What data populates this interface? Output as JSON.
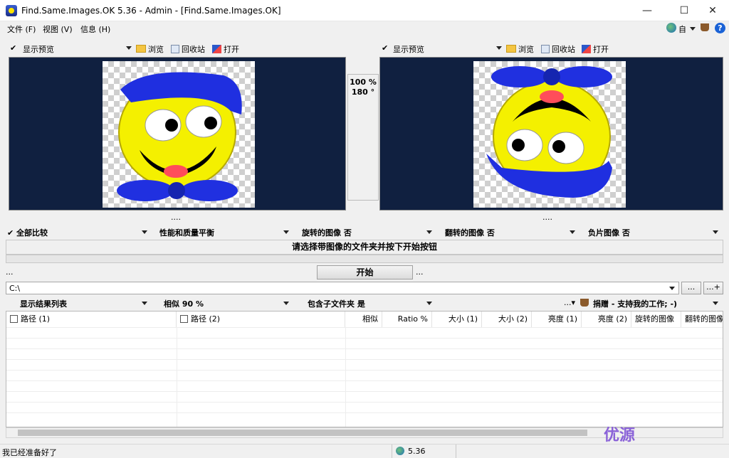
{
  "window": {
    "title": "Find.Same.Images.OK 5.36 - Admin - [Find.Same.Images.OK]",
    "minimize": "—",
    "maximize": "☐",
    "close": "✕"
  },
  "menu": {
    "file": "文件 (F)",
    "view": "视图 (V)",
    "info": "信息 (H)"
  },
  "left_toolbar": {
    "show_preview": "显示预览",
    "browse": "浏览",
    "recycle": "回收站",
    "open": "打开"
  },
  "right_toolbar": {
    "show_preview": "显示预览",
    "browse": "浏览",
    "recycle": "回收站",
    "open": "打开"
  },
  "zoom": {
    "percent": "100 %",
    "rotation": "180 °"
  },
  "dots": "....",
  "options": {
    "compare_all": "全部比较",
    "balance": "性能和质量平衡",
    "rotated": "旋转的图像 否",
    "flipped": "翻转的图像 否",
    "negative": "负片图像 否"
  },
  "status_message": "请选择带图像的文件夹并按下开始按钮",
  "start": {
    "left_dots": "...",
    "label": "开始",
    "right_dots": "..."
  },
  "path": {
    "value": "C:\\",
    "browse_btn": "...",
    "add_btn": "...+"
  },
  "result_options": {
    "show_results": "显示结果列表",
    "similarity": "相似 90 %",
    "subfolders": "包含子文件夹 是",
    "donate": "捐赠 - 支持我的工作; -)"
  },
  "grid_headers": {
    "path1": "路径 (1)",
    "path2": "路径 (2)",
    "similar": "相似",
    "ratio": "Ratio %",
    "size1": "大小 (1)",
    "size2": "大小 (2)",
    "bright1": "亮度 (1)",
    "bright2": "亮度 (2)",
    "rotated": "旋转的图像",
    "flipped": "翻转的图像"
  },
  "statusbar": {
    "ready": "我已经准备好了",
    "version": "5.36"
  },
  "watermark": "优源"
}
